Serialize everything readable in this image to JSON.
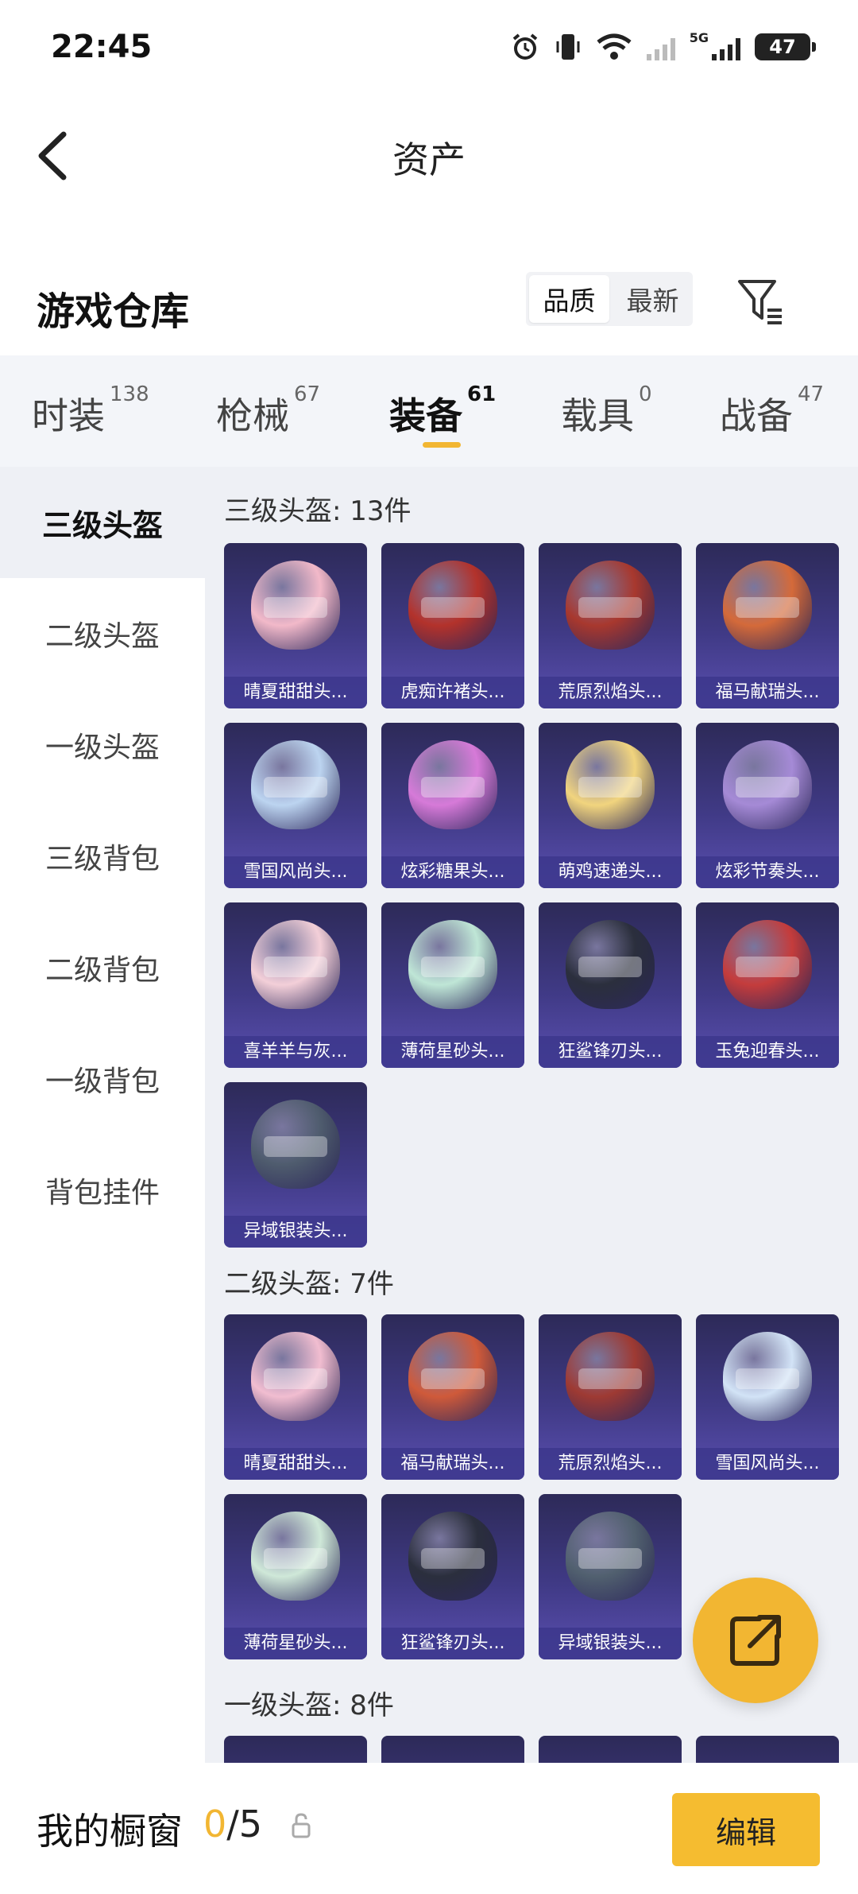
{
  "status_bar": {
    "time": "22:45",
    "battery": "47",
    "network": "5G"
  },
  "header": {
    "title": "资产",
    "back_icon": "chevron-left-icon"
  },
  "warehouse": {
    "title": "游戏仓库",
    "sort_options": [
      "品质",
      "最新"
    ],
    "sort_selected": "品质",
    "filter_icon": "filter-icon"
  },
  "tabs": [
    {
      "label": "时装",
      "count": "138",
      "active": false
    },
    {
      "label": "枪械",
      "count": "67",
      "active": false
    },
    {
      "label": "装备",
      "count": "61",
      "active": true
    },
    {
      "label": "载具",
      "count": "0",
      "active": false
    },
    {
      "label": "战备",
      "count": "47",
      "active": false
    }
  ],
  "sidebar": {
    "items": [
      {
        "label": "三级头盔",
        "active": true
      },
      {
        "label": "二级头盔",
        "active": false
      },
      {
        "label": "一级头盔",
        "active": false
      },
      {
        "label": "三级背包",
        "active": false
      },
      {
        "label": "二级背包",
        "active": false
      },
      {
        "label": "一级背包",
        "active": false
      },
      {
        "label": "背包挂件",
        "active": false
      }
    ]
  },
  "sections": [
    {
      "title": "三级头盔: 13件",
      "items": [
        {
          "name": "晴夏甜甜头...",
          "color": "#f2b9c9"
        },
        {
          "name": "虎痴许褚头...",
          "color": "#b3322b"
        },
        {
          "name": "荒原烈焰头...",
          "color": "#a8382e"
        },
        {
          "name": "福马献瑞头...",
          "color": "#d46a3a"
        },
        {
          "name": "雪国风尚头...",
          "color": "#bcd4f0"
        },
        {
          "name": "炫彩糖果头...",
          "color": "#d67ad8"
        },
        {
          "name": "萌鸡速递头...",
          "color": "#f1d47e"
        },
        {
          "name": "炫彩节奏头...",
          "color": "#a58ad6"
        },
        {
          "name": "喜羊羊与灰...",
          "color": "#f3cfd8"
        },
        {
          "name": "薄荷星砂头...",
          "color": "#bfe6d6"
        },
        {
          "name": "狂鲨锋刃头...",
          "color": "#2b2f3d"
        },
        {
          "name": "玉兔迎春头...",
          "color": "#c43c3c"
        },
        {
          "name": "异域银装头...",
          "color": "#4f5c6e"
        }
      ]
    },
    {
      "title": "二级头盔: 7件",
      "items": [
        {
          "name": "晴夏甜甜头...",
          "color": "#f1bdd0"
        },
        {
          "name": "福马献瑞头...",
          "color": "#cf5a3a"
        },
        {
          "name": "荒原烈焰头...",
          "color": "#9e3a33"
        },
        {
          "name": "雪国风尚头...",
          "color": "#d2e3f6"
        },
        {
          "name": "薄荷星砂头...",
          "color": "#cfe8d8"
        },
        {
          "name": "狂鲨锋刃头...",
          "color": "#2b2f3d"
        },
        {
          "name": "异域银装头...",
          "color": "#51606f"
        }
      ]
    },
    {
      "title": "一级头盔: 8件",
      "items": []
    }
  ],
  "bottom_bar": {
    "title": "我的橱窗",
    "count_current": "0",
    "count_sep": "/5",
    "lock_icon": "lock-icon",
    "edit_label": "编辑"
  },
  "fab_icon": "share-external-icon",
  "accent_color": "#f2b632"
}
